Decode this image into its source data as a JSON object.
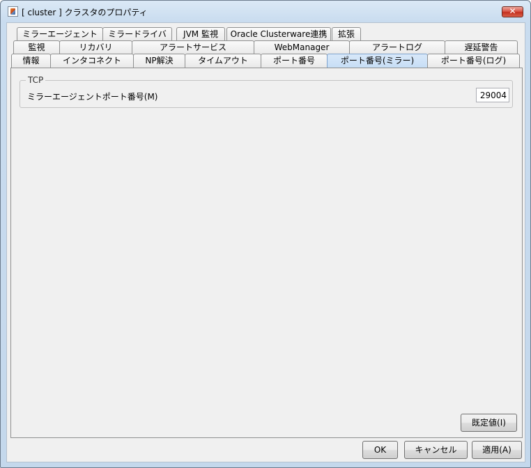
{
  "window": {
    "title": "[ cluster ] クラスタのプロパティ",
    "app_icon": "java-cup-icon",
    "close_glyph": "✕"
  },
  "tabs": {
    "row1": [
      "ミラーエージェント",
      "ミラードライバ",
      "JVM 監視",
      "Oracle Clusterware連携",
      "拡張"
    ],
    "row2": [
      "監視",
      "リカバリ",
      "アラートサービス",
      "WebManager",
      "アラートログ",
      "遅延警告"
    ],
    "row3": [
      "情報",
      "インタコネクト",
      "NP解決",
      "タイムアウト",
      "ポート番号",
      "ポート番号(ミラー)",
      "ポート番号(ログ)"
    ],
    "selected": "ポート番号(ミラー)"
  },
  "panel": {
    "group_title": "TCP",
    "field_label": "ミラーエージェントポート番号(M)",
    "port_value": "29004"
  },
  "buttons": {
    "default_label": "既定値(I)",
    "ok_label": "OK",
    "cancel_label": "キャンセル",
    "apply_label": "適用(A)"
  }
}
